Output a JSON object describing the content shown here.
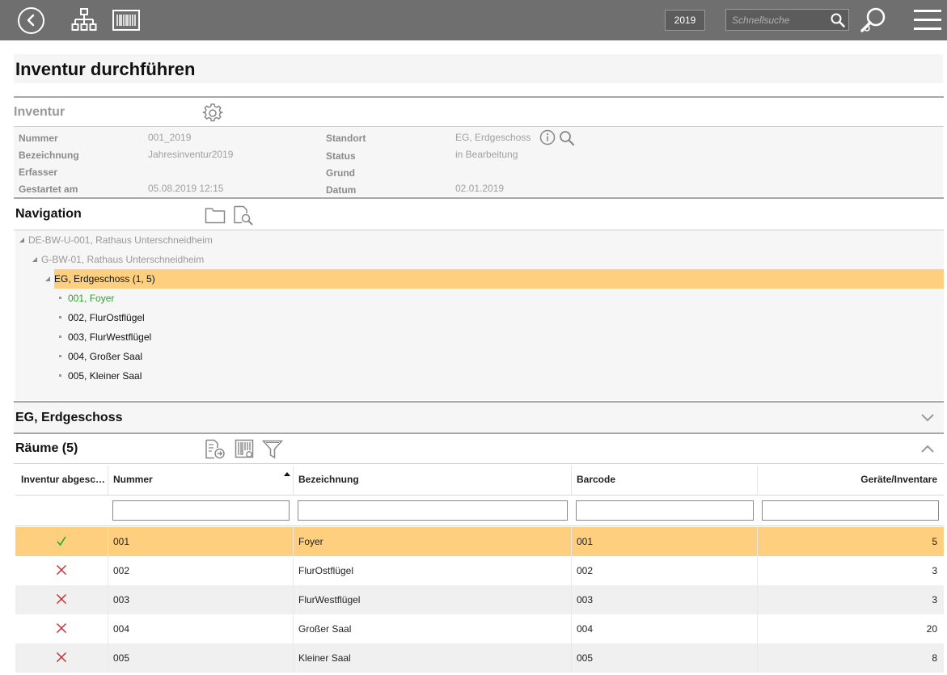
{
  "topbar": {
    "year": "2019",
    "search_placeholder": "Schnellsuche"
  },
  "page_title": "Inventur durchführen",
  "inventur": {
    "section_title": "Inventur",
    "fields_left": [
      {
        "label": "Nummer",
        "value": "001_2019"
      },
      {
        "label": "Bezeichnung",
        "value": "Jahresinventur2019"
      },
      {
        "label": "Erfasser",
        "value": ""
      },
      {
        "label": "Gestartet am",
        "value": "05.08.2019 12:15"
      }
    ],
    "fields_right": [
      {
        "label": "Standort",
        "value": "EG, Erdgeschoss"
      },
      {
        "label": "Status",
        "value": "in Bearbeitung"
      },
      {
        "label": "Grund",
        "value": ""
      },
      {
        "label": "Datum",
        "value": "02.01.2019"
      }
    ]
  },
  "navigation": {
    "section_title": "Navigation",
    "tree": [
      {
        "label": "DE-BW-U-001, Rathaus Unterschneidheim",
        "level": 0
      },
      {
        "label": "G-BW-01, Rathaus Unterschneidheim",
        "level": 1
      },
      {
        "label": "EG, Erdgeschoss (1, 5)",
        "level": 2,
        "selected": true
      },
      {
        "label": "001, Foyer",
        "level": 3,
        "done": true
      },
      {
        "label": "002, FlurOstflügel",
        "level": 3
      },
      {
        "label": "003, FlurWestflügel",
        "level": 3
      },
      {
        "label": "004, Großer Saal",
        "level": 3
      },
      {
        "label": "005, Kleiner Saal",
        "level": 3
      }
    ]
  },
  "eg_section": {
    "title": "EG, Erdgeschoss"
  },
  "rooms": {
    "title": "Räume (5)",
    "columns": [
      "Inventur abgeschlossen",
      "Nummer",
      "Bezeichnung",
      "Barcode",
      "Geräte/Inventare"
    ],
    "rows": [
      {
        "done": true,
        "nummer": "001",
        "bezeichnung": "Foyer",
        "barcode": "001",
        "geraete": "5"
      },
      {
        "done": false,
        "nummer": "002",
        "bezeichnung": "FlurOstflügel",
        "barcode": "002",
        "geraete": "3"
      },
      {
        "done": false,
        "nummer": "003",
        "bezeichnung": "FlurWestflügel",
        "barcode": "003",
        "geraete": "3"
      },
      {
        "done": false,
        "nummer": "004",
        "bezeichnung": "Großer Saal",
        "barcode": "004",
        "geraete": "20"
      },
      {
        "done": false,
        "nummer": "005",
        "bezeichnung": "Kleiner Saal",
        "barcode": "005",
        "geraete": "8"
      }
    ]
  },
  "colors": {
    "topbar": "#6f6f6f",
    "highlight": "#fdcf7f",
    "done_green": "#2aa52a",
    "open_red": "#c03030"
  },
  "icons": [
    "back-icon",
    "hierarchy-icon",
    "barcode-icon",
    "search-icon",
    "large-search-icon",
    "menu-icon",
    "gear-icon",
    "info-icon",
    "folder-icon",
    "document-search-icon",
    "export-icon",
    "barcode-settings-icon",
    "filter-icon",
    "chevron-down-icon",
    "chevron-up-icon",
    "check-icon",
    "cross-icon"
  ]
}
